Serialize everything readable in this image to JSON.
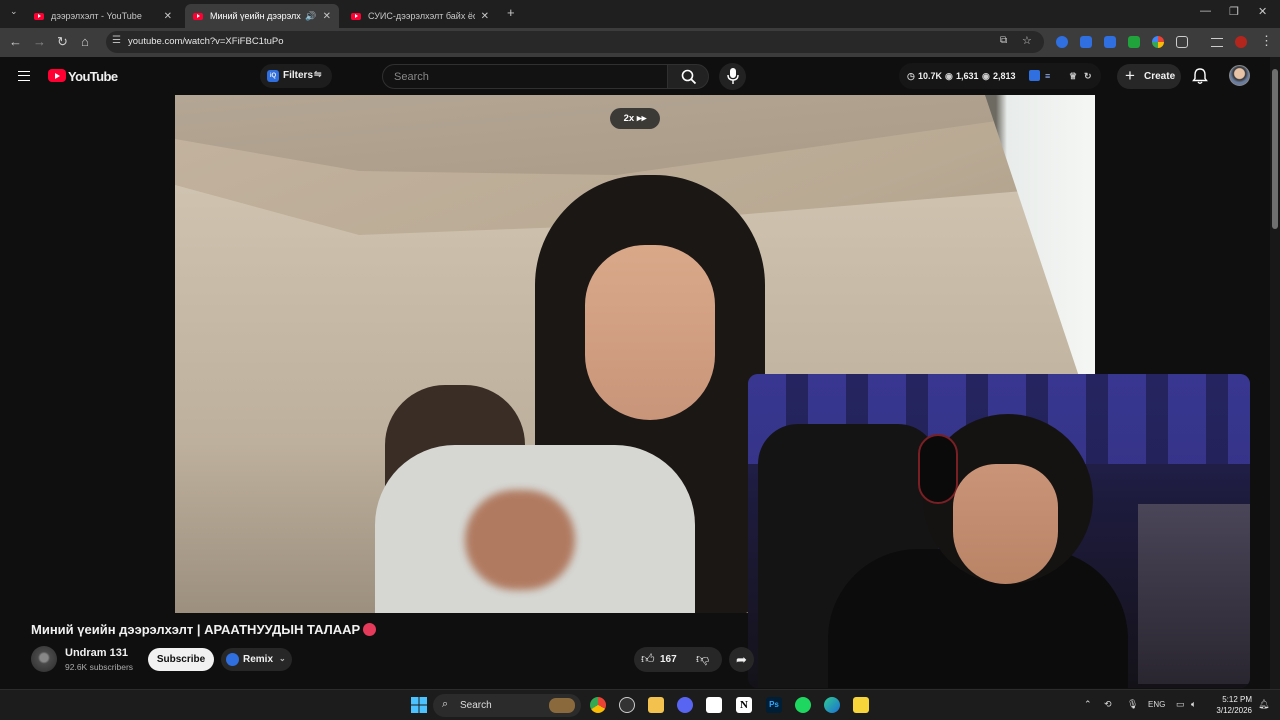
{
  "browser": {
    "tabs": [
      {
        "title": "дээрэлхэлт - YouTube",
        "active": false
      },
      {
        "title": "Миний үеийн дээрэлхэлт |",
        "active": true
      },
      {
        "title": "СУИС-дээрэлхэлт байх ёстой",
        "active": false
      }
    ],
    "new_tab": "+",
    "close_glyph": "✕",
    "url": "youtube.com/watch?v=XFiFBC1tuPo"
  },
  "youtube": {
    "logo_text": "YouTube",
    "filters_label": "Filters",
    "search_placeholder": "Search",
    "stats": {
      "views": "10.7K",
      "likes": "1,631",
      "watching": "2,813"
    },
    "create_label": "Create",
    "speed_label": "2x",
    "video": {
      "title": "Миний үеийн дээрэлхэлт | АРААТНУУДЫН ТАЛААР",
      "channel": "Undram 131",
      "subscribers": "92.6K subscribers",
      "subscribe_label": "Subscribe",
      "remix_label": "Remix",
      "like_count": "167"
    }
  },
  "taskbar": {
    "search_label": "Search",
    "language": "ENG",
    "time": "5:12 PM",
    "date": "3/12/2026"
  },
  "colors": {
    "youtube_red": "#ff0033",
    "page_bg": "#0f0f0f",
    "chip_bg": "#272727"
  },
  "icons": [
    "menu-icon",
    "youtube-logo-icon",
    "search-icon",
    "mic-icon",
    "bell-icon",
    "thumbs-up-icon",
    "thumbs-down-icon",
    "share-icon",
    "windows-start-icon"
  ]
}
